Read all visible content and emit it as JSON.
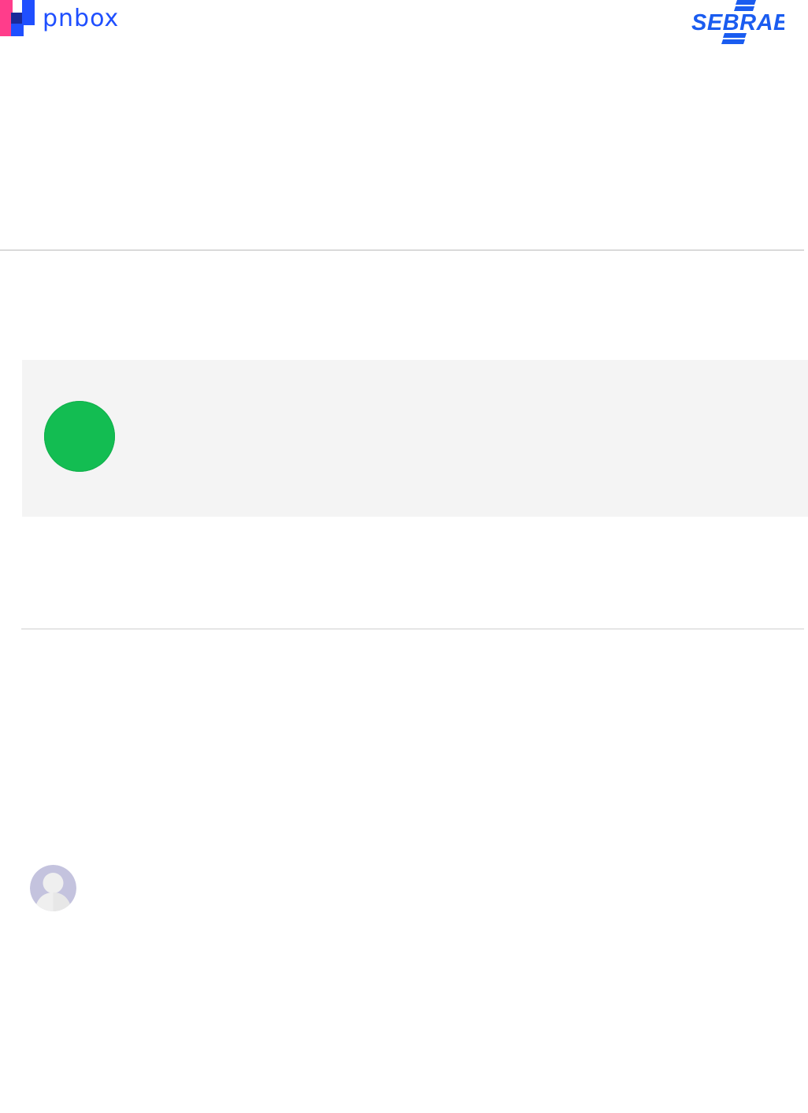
{
  "header": {
    "brand_logo": {
      "text": "pnbox",
      "colors": {
        "pink": "#ff3d8b",
        "blue": "#1f4fff",
        "navy": "#1b2a9a"
      }
    },
    "partner_logo": {
      "text": "SEBRAE",
      "color": "#1a5cf0"
    }
  },
  "status": {
    "state_icon": "status-dot",
    "color": "#13bd52"
  },
  "profile": {
    "avatar_icon": "default-user-avatar",
    "colors": {
      "background": "#c4c3de",
      "figure": "#efefef"
    }
  }
}
